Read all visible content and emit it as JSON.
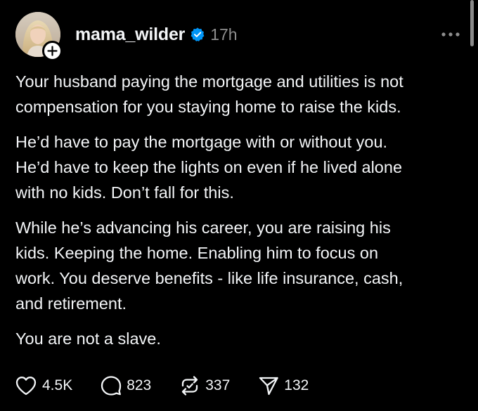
{
  "post": {
    "author": {
      "username": "mama_wilder",
      "verified": true,
      "avatar_icon": "profile-photo",
      "follow_icon": "plus-icon"
    },
    "timestamp": "17h",
    "more_icon": "more-horizontal-icon",
    "paragraphs": [
      "Your husband paying the mortgage and utilities is not\ncompensation for you staying home to raise the kids.",
      "He’d have to pay the mortgage with or without you.\nHe’d have to keep the lights on even if he lived alone\nwith no kids. Don’t fall for this.",
      "While he’s advancing his career, you are raising his\nkids. Keeping the home. Enabling him to focus on\nwork. You deserve benefits - like life insurance, cash,\nand retirement.",
      "You are not a slave."
    ],
    "actions": {
      "like": {
        "icon": "heart-icon",
        "count": "4.5K"
      },
      "reply": {
        "icon": "comment-icon",
        "count": "823"
      },
      "repost": {
        "icon": "repost-icon",
        "count": "337"
      },
      "share": {
        "icon": "send-icon",
        "count": "132"
      }
    }
  },
  "colors": {
    "background": "#000000",
    "text": "#f3f5f7",
    "secondary_text": "#8e8e8e",
    "verified_blue": "#0095f6"
  }
}
